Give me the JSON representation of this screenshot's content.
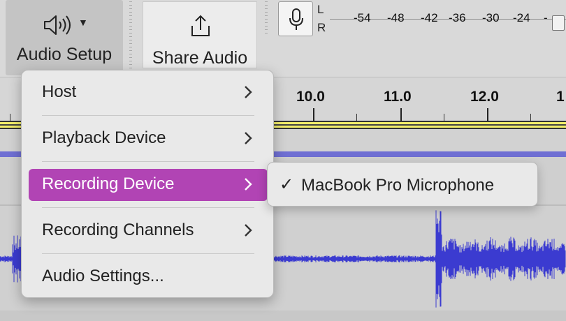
{
  "toolbar": {
    "audio_setup_label": "Audio Setup",
    "share_audio_label": "Share Audio",
    "meter_channels": [
      "L",
      "R"
    ],
    "meter_ticks": [
      "-54",
      "-48",
      "-42",
      "-36",
      "-30",
      "-24",
      "-"
    ]
  },
  "ruler": {
    "labels": [
      "10.0",
      "11.0",
      "12.0",
      "1"
    ]
  },
  "menu": {
    "items": [
      {
        "label": "Host",
        "has_submenu": true
      },
      {
        "label": "Playback Device",
        "has_submenu": true
      },
      {
        "label": "Recording Device",
        "has_submenu": true,
        "active": true
      },
      {
        "label": "Recording Channels",
        "has_submenu": true
      },
      {
        "label": "Audio Settings...",
        "has_submenu": false
      }
    ],
    "active_color": "#b144b4"
  },
  "submenu": {
    "check": "✓",
    "item_label": "MacBook Pro Microphone"
  },
  "colors": {
    "waveform": "#3b3bd0",
    "track_bar": "#6f6fd3",
    "timeline": "#f3ee6a"
  }
}
